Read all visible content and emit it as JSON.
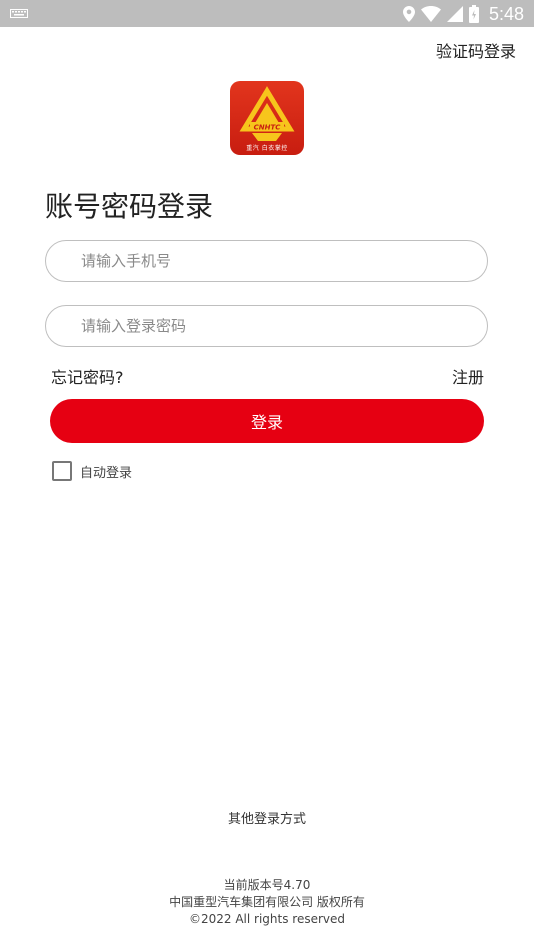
{
  "status_bar": {
    "time": "5:48",
    "icons": [
      "keyboard-icon",
      "location-icon",
      "wifi-icon",
      "signal-icon",
      "battery-icon"
    ]
  },
  "header": {
    "sms_login_label": "验证码登录"
  },
  "logo": {
    "brand_text": "CNHTC",
    "caption": "重汽 白衣掌控",
    "colors": {
      "background": "#d72a16",
      "emblem": "#f7c51c"
    }
  },
  "page_title": "账号密码登录",
  "form": {
    "phone_placeholder": "请输入手机号",
    "phone_value": "",
    "password_placeholder": "请输入登录密码",
    "password_value": "",
    "forgot_password_label": "忘记密码?",
    "register_label": "注册",
    "login_button_label": "登录",
    "auto_login_label": "自动登录",
    "auto_login_checked": false
  },
  "other_login_label": "其他登录方式",
  "footer": {
    "version": "当前版本号4.70",
    "company": "中国重型汽车集团有限公司 版权所有",
    "copyright": "©2022 All rights reserved"
  },
  "colors": {
    "accent": "#e60012",
    "status_bar": "#bdbdbd"
  }
}
